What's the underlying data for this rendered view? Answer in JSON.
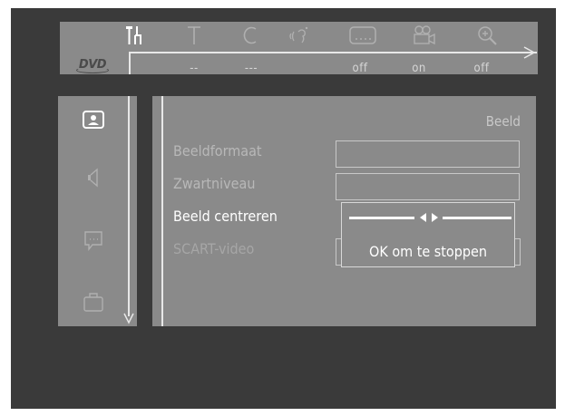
{
  "topbar": {
    "icons": [
      {
        "name": "settings-tools-icon",
        "active": true
      },
      {
        "name": "title-icon",
        "glyph": "T"
      },
      {
        "name": "chapter-icon",
        "glyph": "C"
      },
      {
        "name": "audio-language-icon"
      },
      {
        "name": "subtitle-icon"
      },
      {
        "name": "camera-angle-icon"
      },
      {
        "name": "zoom-icon"
      }
    ],
    "values": {
      "title": "--",
      "chapter": "---",
      "subtitle": "off",
      "angle": "on",
      "zoom": "off"
    },
    "logo": "DVD"
  },
  "sidebar": {
    "icons": [
      "picture-icon",
      "speaker-icon",
      "speech-bubble-icon",
      "briefcase-icon"
    ]
  },
  "panel": {
    "title": "Beeld",
    "rows": [
      {
        "label": "Beeldformaat",
        "state": "normal"
      },
      {
        "label": "Zwartniveau",
        "state": "normal"
      },
      {
        "label": "Beeld centreren",
        "state": "active"
      },
      {
        "label": "SCART-video",
        "state": "dim"
      }
    ],
    "popup": {
      "message": "OK om te stoppen",
      "slider_position": 0.5
    }
  },
  "colors": {
    "screen_bg": "#3a3a3a",
    "panel_bg": "#8a8a8a",
    "line": "#e8e8e8",
    "active_text": "#ffffff"
  }
}
